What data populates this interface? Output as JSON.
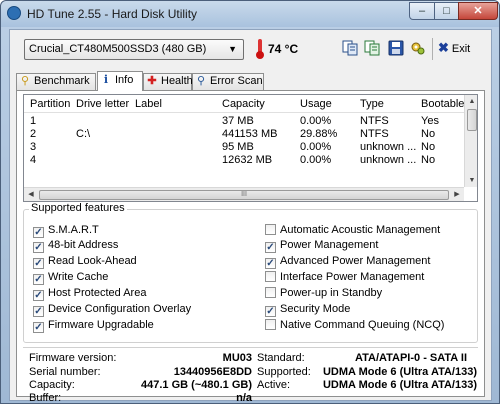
{
  "window": {
    "title": "HD Tune 2.55 - Hard Disk Utility"
  },
  "toolbar": {
    "drive": "Crucial_CT480M500SSD3 (480 GB)",
    "temperature": "74 °C",
    "exit_label": "Exit"
  },
  "tabs": [
    {
      "label": "Benchmark",
      "icon": "benchmark-icon",
      "active": false
    },
    {
      "label": "Info",
      "icon": "info-icon",
      "active": true
    },
    {
      "label": "Health",
      "icon": "health-icon",
      "active": false
    },
    {
      "label": "Error Scan",
      "icon": "magnifier-icon",
      "active": false
    }
  ],
  "partitions": {
    "headers": [
      "Partition",
      "Drive letter",
      "Label",
      "Capacity",
      "Usage",
      "Type",
      "Bootable"
    ],
    "rows": [
      [
        "1",
        "",
        "",
        "37 MB",
        "0.00%",
        "NTFS",
        "Yes"
      ],
      [
        "2",
        "C:\\",
        "",
        "441153 MB",
        "29.88%",
        "NTFS",
        "No"
      ],
      [
        "3",
        "",
        "",
        "95 MB",
        "0.00%",
        "unknown ...",
        "No"
      ],
      [
        "4",
        "",
        "",
        "12632 MB",
        "0.00%",
        "unknown ...",
        "No"
      ]
    ],
    "scroll_label": "III"
  },
  "features": {
    "legend": "Supported features",
    "left": [
      {
        "label": "S.M.A.R.T",
        "checked": true
      },
      {
        "label": "48-bit Address",
        "checked": true
      },
      {
        "label": "Read Look-Ahead",
        "checked": true
      },
      {
        "label": "Write Cache",
        "checked": true
      },
      {
        "label": "Host Protected Area",
        "checked": true
      },
      {
        "label": "Device Configuration Overlay",
        "checked": true
      },
      {
        "label": "Firmware Upgradable",
        "checked": true
      }
    ],
    "right": [
      {
        "label": "Automatic Acoustic Management",
        "checked": false
      },
      {
        "label": "Power Management",
        "checked": true
      },
      {
        "label": "Advanced Power Management",
        "checked": true
      },
      {
        "label": "Interface Power Management",
        "checked": false
      },
      {
        "label": "Power-up in Standby",
        "checked": false
      },
      {
        "label": "Security Mode",
        "checked": true
      },
      {
        "label": "Native Command Queuing (NCQ)",
        "checked": false
      }
    ]
  },
  "details": {
    "firmware_label": "Firmware version:",
    "firmware": "MU03",
    "serial_label": "Serial number:",
    "serial": "13440956E8DD",
    "capacity_label": "Capacity:",
    "capacity": "447.1 GB (~480.1 GB)",
    "buffer_label": "Buffer:",
    "buffer": "n/a",
    "standard_label": "Standard:",
    "standard": "ATA/ATAPI-0 - SATA II",
    "supported_label": "Supported:",
    "supported": "UDMA Mode 6 (Ultra ATA/133)",
    "active_label": "Active:",
    "active": "UDMA Mode 6 (Ultra ATA/133)"
  }
}
